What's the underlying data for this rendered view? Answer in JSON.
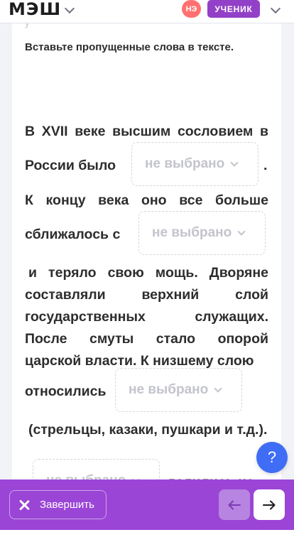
{
  "header": {
    "logo": "МЭШ",
    "avatar_initials": "НЭ",
    "role_label": "УЧЕНИК"
  },
  "card": {
    "faded_text": "у",
    "instruction": "Вставьте пропущенные слова в тексте.",
    "text": {
      "p1": "В XVII веке высшим сословием в",
      "p2": "России было",
      "p3": ".",
      "p4": "К концу века оно все больше",
      "p5": "сближалось с",
      "p6": "и теряло свою мощь. Дворяне составляли верхний слой государственных служащих. После смуты стало опорой царской власти. К низшему слою",
      "p7": "относились",
      "p8": "(стрельцы, казаки, пушкари и т.д.).",
      "p9": "делились на"
    },
    "dropdowns": [
      {
        "label": "не выбрано"
      },
      {
        "label": "не выбрано"
      },
      {
        "label": "не выбрано"
      },
      {
        "label": "не выбрано"
      }
    ]
  },
  "help_label": "?",
  "footer": {
    "finish_label": "Завершить"
  },
  "colors": {
    "accent": "#9b45d6",
    "help": "#3f6df5",
    "avatar": "#ff7170"
  }
}
